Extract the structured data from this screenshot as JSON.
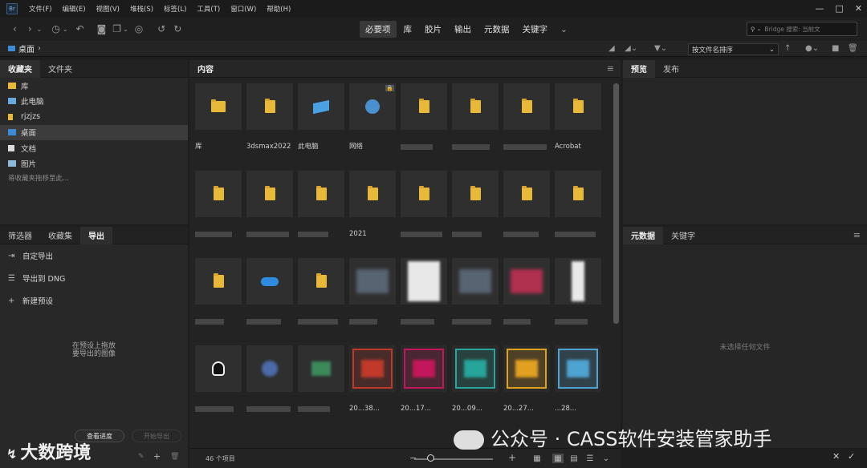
{
  "app": {
    "logo_text": "Br"
  },
  "menu": [
    "文件(F)",
    "编辑(E)",
    "视图(V)",
    "堆栈(S)",
    "标签(L)",
    "工具(T)",
    "窗口(W)",
    "帮助(H)"
  ],
  "window_controls": {
    "minimize": "—",
    "restore": "□",
    "close": "✕"
  },
  "workspaces": [
    "必要项",
    "库",
    "胶片",
    "输出",
    "元数据",
    "关键字"
  ],
  "workspace_more": "⌄",
  "search": {
    "placeholder": "Bridge 搜索: 当前文"
  },
  "path": {
    "current": "桌面",
    "separator": "›"
  },
  "sort": {
    "label": "按文件名排序",
    "arrow": "↑"
  },
  "favorites_panel": {
    "tabs": [
      "收藏夹",
      "文件夹"
    ],
    "items": [
      {
        "label": "库",
        "icon": "library-icon",
        "color": "#e8b83a"
      },
      {
        "label": "此电脑",
        "icon": "computer-icon",
        "color": "#6aa8e0"
      },
      {
        "label": "rjzjzs",
        "icon": "folder-icon",
        "color": "#e8b83a"
      },
      {
        "label": "桌面",
        "icon": "desktop-icon",
        "color": "#3d8bd4"
      },
      {
        "label": "文档",
        "icon": "document-icon",
        "color": "#dcdcdc"
      },
      {
        "label": "图片",
        "icon": "picture-icon",
        "color": "#8fb8d8"
      }
    ],
    "hint": "将收藏夹拖移至此..."
  },
  "export_panel": {
    "tabs": [
      "筛选器",
      "收藏集",
      "导出"
    ],
    "items": [
      {
        "label": "自定导出",
        "icon": "export-icon",
        "glyph": "⇥"
      },
      {
        "label": "导出到 DNG",
        "icon": "list-icon",
        "glyph": "☰"
      },
      {
        "label": "新建预设",
        "icon": "plus-icon",
        "glyph": "+"
      }
    ],
    "drop_hint_line1": "在预设上拖放",
    "drop_hint_line2": "要导出的图像",
    "progress_button": "查看进度",
    "start_export_button": "开始导出"
  },
  "content": {
    "tab": "内容",
    "status_count": "46 个项目",
    "cells": [
      {
        "label": "库",
        "type": "library"
      },
      {
        "label": "3dsmax2022",
        "type": "folder"
      },
      {
        "label": "此电脑",
        "type": "computer"
      },
      {
        "label": "网络",
        "type": "network"
      },
      {
        "label": "",
        "type": "folder"
      },
      {
        "label": "",
        "type": "folder"
      },
      {
        "label": "",
        "type": "folder"
      },
      {
        "label": "Acrobat",
        "type": "folder"
      },
      {
        "label": "",
        "type": "folder"
      },
      {
        "label": "",
        "type": "folder"
      },
      {
        "label": "",
        "type": "folder"
      },
      {
        "label": "2021",
        "type": "folder"
      },
      {
        "label": "",
        "type": "folder"
      },
      {
        "label": "",
        "type": "folder"
      },
      {
        "label": "",
        "type": "folder"
      },
      {
        "label": "",
        "type": "folder"
      },
      {
        "label": "",
        "type": "folder"
      },
      {
        "label": "",
        "type": "cloud"
      },
      {
        "label": "",
        "type": "folder"
      },
      {
        "label": "",
        "type": "image"
      },
      {
        "label": "",
        "type": "doc"
      },
      {
        "label": "",
        "type": "image"
      },
      {
        "label": "",
        "type": "image-red"
      },
      {
        "label": "",
        "type": "doc"
      },
      {
        "label": "",
        "type": "qq"
      },
      {
        "label": "",
        "type": "app"
      },
      {
        "label": "",
        "type": "wechat"
      },
      {
        "label": "20...38...",
        "type": "app-frame",
        "color": "#c0392b"
      },
      {
        "label": "20...17...",
        "type": "app-frame",
        "color": "#c2185b"
      },
      {
        "label": "20...09...",
        "type": "app-frame",
        "color": "#26a69a"
      },
      {
        "label": "20...27...",
        "type": "app-frame",
        "color": "#e0a020"
      },
      {
        "label": "...28...",
        "type": "app-frame",
        "color": "#4fa3d1"
      }
    ]
  },
  "preview_panel": {
    "tabs": [
      "预览",
      "发布"
    ]
  },
  "metadata_panel": {
    "tabs": [
      "元数据",
      "关键字"
    ],
    "empty_text": "未选择任何文件"
  },
  "watermark": {
    "left": "大数跨境",
    "right": "公众号 · CASS软件安装管家助手"
  }
}
